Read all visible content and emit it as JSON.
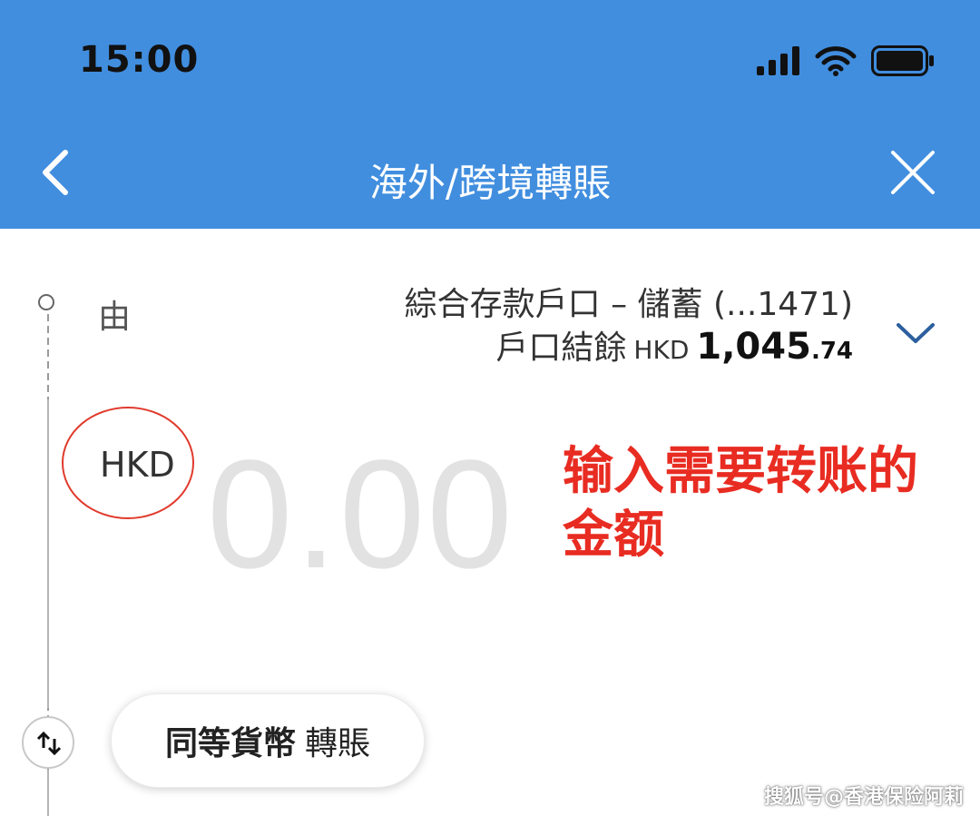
{
  "status_bar": {
    "time": "15:00",
    "icons": [
      "signal-icon",
      "wifi-icon",
      "battery-icon"
    ]
  },
  "nav": {
    "title": "海外/跨境轉賬",
    "back_icon": "chevron-left-icon",
    "close_icon": "close-icon"
  },
  "from": {
    "label": "由",
    "account_name": "綜合存款戶口 – 儲蓄 (...1471)",
    "balance_label": "戶口結餘",
    "balance_currency": "HKD",
    "balance_int": "1,045",
    "balance_dec": ".74"
  },
  "amount": {
    "currency": "HKD",
    "placeholder": "0.00"
  },
  "annotation": {
    "text": "输入需要转账的金额"
  },
  "equal_currency": {
    "bold_label": "同等貨幣",
    "label": "轉賬"
  },
  "watermark": "搜狐号@香港保险阿莉",
  "colors": {
    "header_bg": "#418edf",
    "annotation_red": "#e82c22",
    "chevron_blue": "#2c5f9e"
  }
}
